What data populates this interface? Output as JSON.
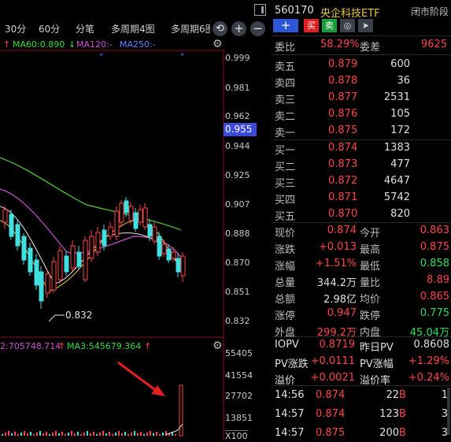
{
  "toolbar": {
    "tabs": [
      "30分",
      "60分",
      "分笔",
      "多周期4图",
      "多周期6图"
    ],
    "refresh_icon": "refresh-icon",
    "zoom_in": "+",
    "zoom_out": "−"
  },
  "indicators": {
    "ma60": "MA60:0.890",
    "ma60_arrow": "↓",
    "ma120": "MA120:-",
    "ma250": "MA250:-",
    "vol_ma2": "2:705748.714",
    "vol_ma2_arrow": "↑",
    "vol_ma3": "MA3:545679.364",
    "vol_ma3_arrow": "↑"
  },
  "price_axis": [
    "0.999",
    "0.981",
    "0.962",
    "0.944",
    "0.925",
    "0.907",
    "0.888",
    "0.870",
    "0.851",
    "0.832"
  ],
  "current_price_marker": "0.955",
  "low_annotation": "0.832",
  "volume_axis": [
    "55405",
    "41554",
    "27702",
    "13851"
  ],
  "volume_unit": "X100",
  "stock": {
    "code": "560170",
    "name": "央企科技ETF",
    "status": "闭市阶段",
    "buttons": {
      "add": "+",
      "buy": "买",
      "sell": "卖"
    }
  },
  "ratio": {
    "label1": "委比",
    "value1": "58.29%",
    "label2": "委差",
    "value2": "9625"
  },
  "asks": [
    {
      "label": "卖五",
      "price": "0.879",
      "vol": "600"
    },
    {
      "label": "卖四",
      "price": "0.878",
      "vol": "36"
    },
    {
      "label": "卖三",
      "price": "0.877",
      "vol": "2531"
    },
    {
      "label": "卖二",
      "price": "0.876",
      "vol": "105"
    },
    {
      "label": "卖一",
      "price": "0.875",
      "vol": "172"
    }
  ],
  "bids": [
    {
      "label": "买一",
      "price": "0.874",
      "vol": "1383"
    },
    {
      "label": "买二",
      "price": "0.873",
      "vol": "477"
    },
    {
      "label": "买三",
      "price": "0.872",
      "vol": "4647"
    },
    {
      "label": "买四",
      "price": "0.871",
      "vol": "5742"
    },
    {
      "label": "买五",
      "price": "0.870",
      "vol": "820"
    }
  ],
  "stats": [
    {
      "l1": "现价",
      "v1": "0.874",
      "c1": "red",
      "l2": "今开",
      "v2": "0.863",
      "c2": "red"
    },
    {
      "l1": "涨跌",
      "v1": "+0.013",
      "c1": "red",
      "l2": "最高",
      "v2": "0.875",
      "c2": "red"
    },
    {
      "l1": "涨幅",
      "v1": "+1.51%",
      "c1": "red",
      "l2": "最低",
      "v2": "0.858",
      "c2": "green"
    },
    {
      "l1": "总量",
      "v1": "344.2万",
      "c1": "wht",
      "l2": "量比",
      "v2": "8.89",
      "c2": "red"
    },
    {
      "l1": "总额",
      "v1": "2.98亿",
      "c1": "wht",
      "l2": "均价",
      "v2": "0.865",
      "c2": "red"
    },
    {
      "l1": "涨停",
      "v1": "0.947",
      "c1": "red",
      "l2": "跌停",
      "v2": "0.775",
      "c2": "green"
    },
    {
      "l1": "外盘",
      "v1": "299.2万",
      "c1": "red",
      "l2": "内盘",
      "v2": "45.04万",
      "c2": "green"
    }
  ],
  "iopv": [
    {
      "l1": "IOPV",
      "v1": "0.8719",
      "c1": "red",
      "l2": "昨日PV",
      "v2": "0.8608",
      "c2": "wht"
    },
    {
      "l1": "PV涨跌",
      "v1": "+0.0111",
      "c1": "red",
      "l2": "PV涨幅",
      "v2": "+1.29%",
      "c2": "red"
    },
    {
      "l1": "溢价",
      "v1": "+0.0021",
      "c1": "red",
      "l2": "溢价率",
      "v2": "+0.24%",
      "c2": "red"
    }
  ],
  "ticks": [
    {
      "time": "14:56",
      "price": "0.874",
      "vol": "22",
      "side": "B",
      "count": "1"
    },
    {
      "time": "14:57",
      "price": "0.874",
      "vol": "123",
      "side": "B",
      "count": "3"
    },
    {
      "time": "14:57",
      "price": "0.875",
      "vol": "200",
      "side": "B",
      "count": "3"
    }
  ]
}
